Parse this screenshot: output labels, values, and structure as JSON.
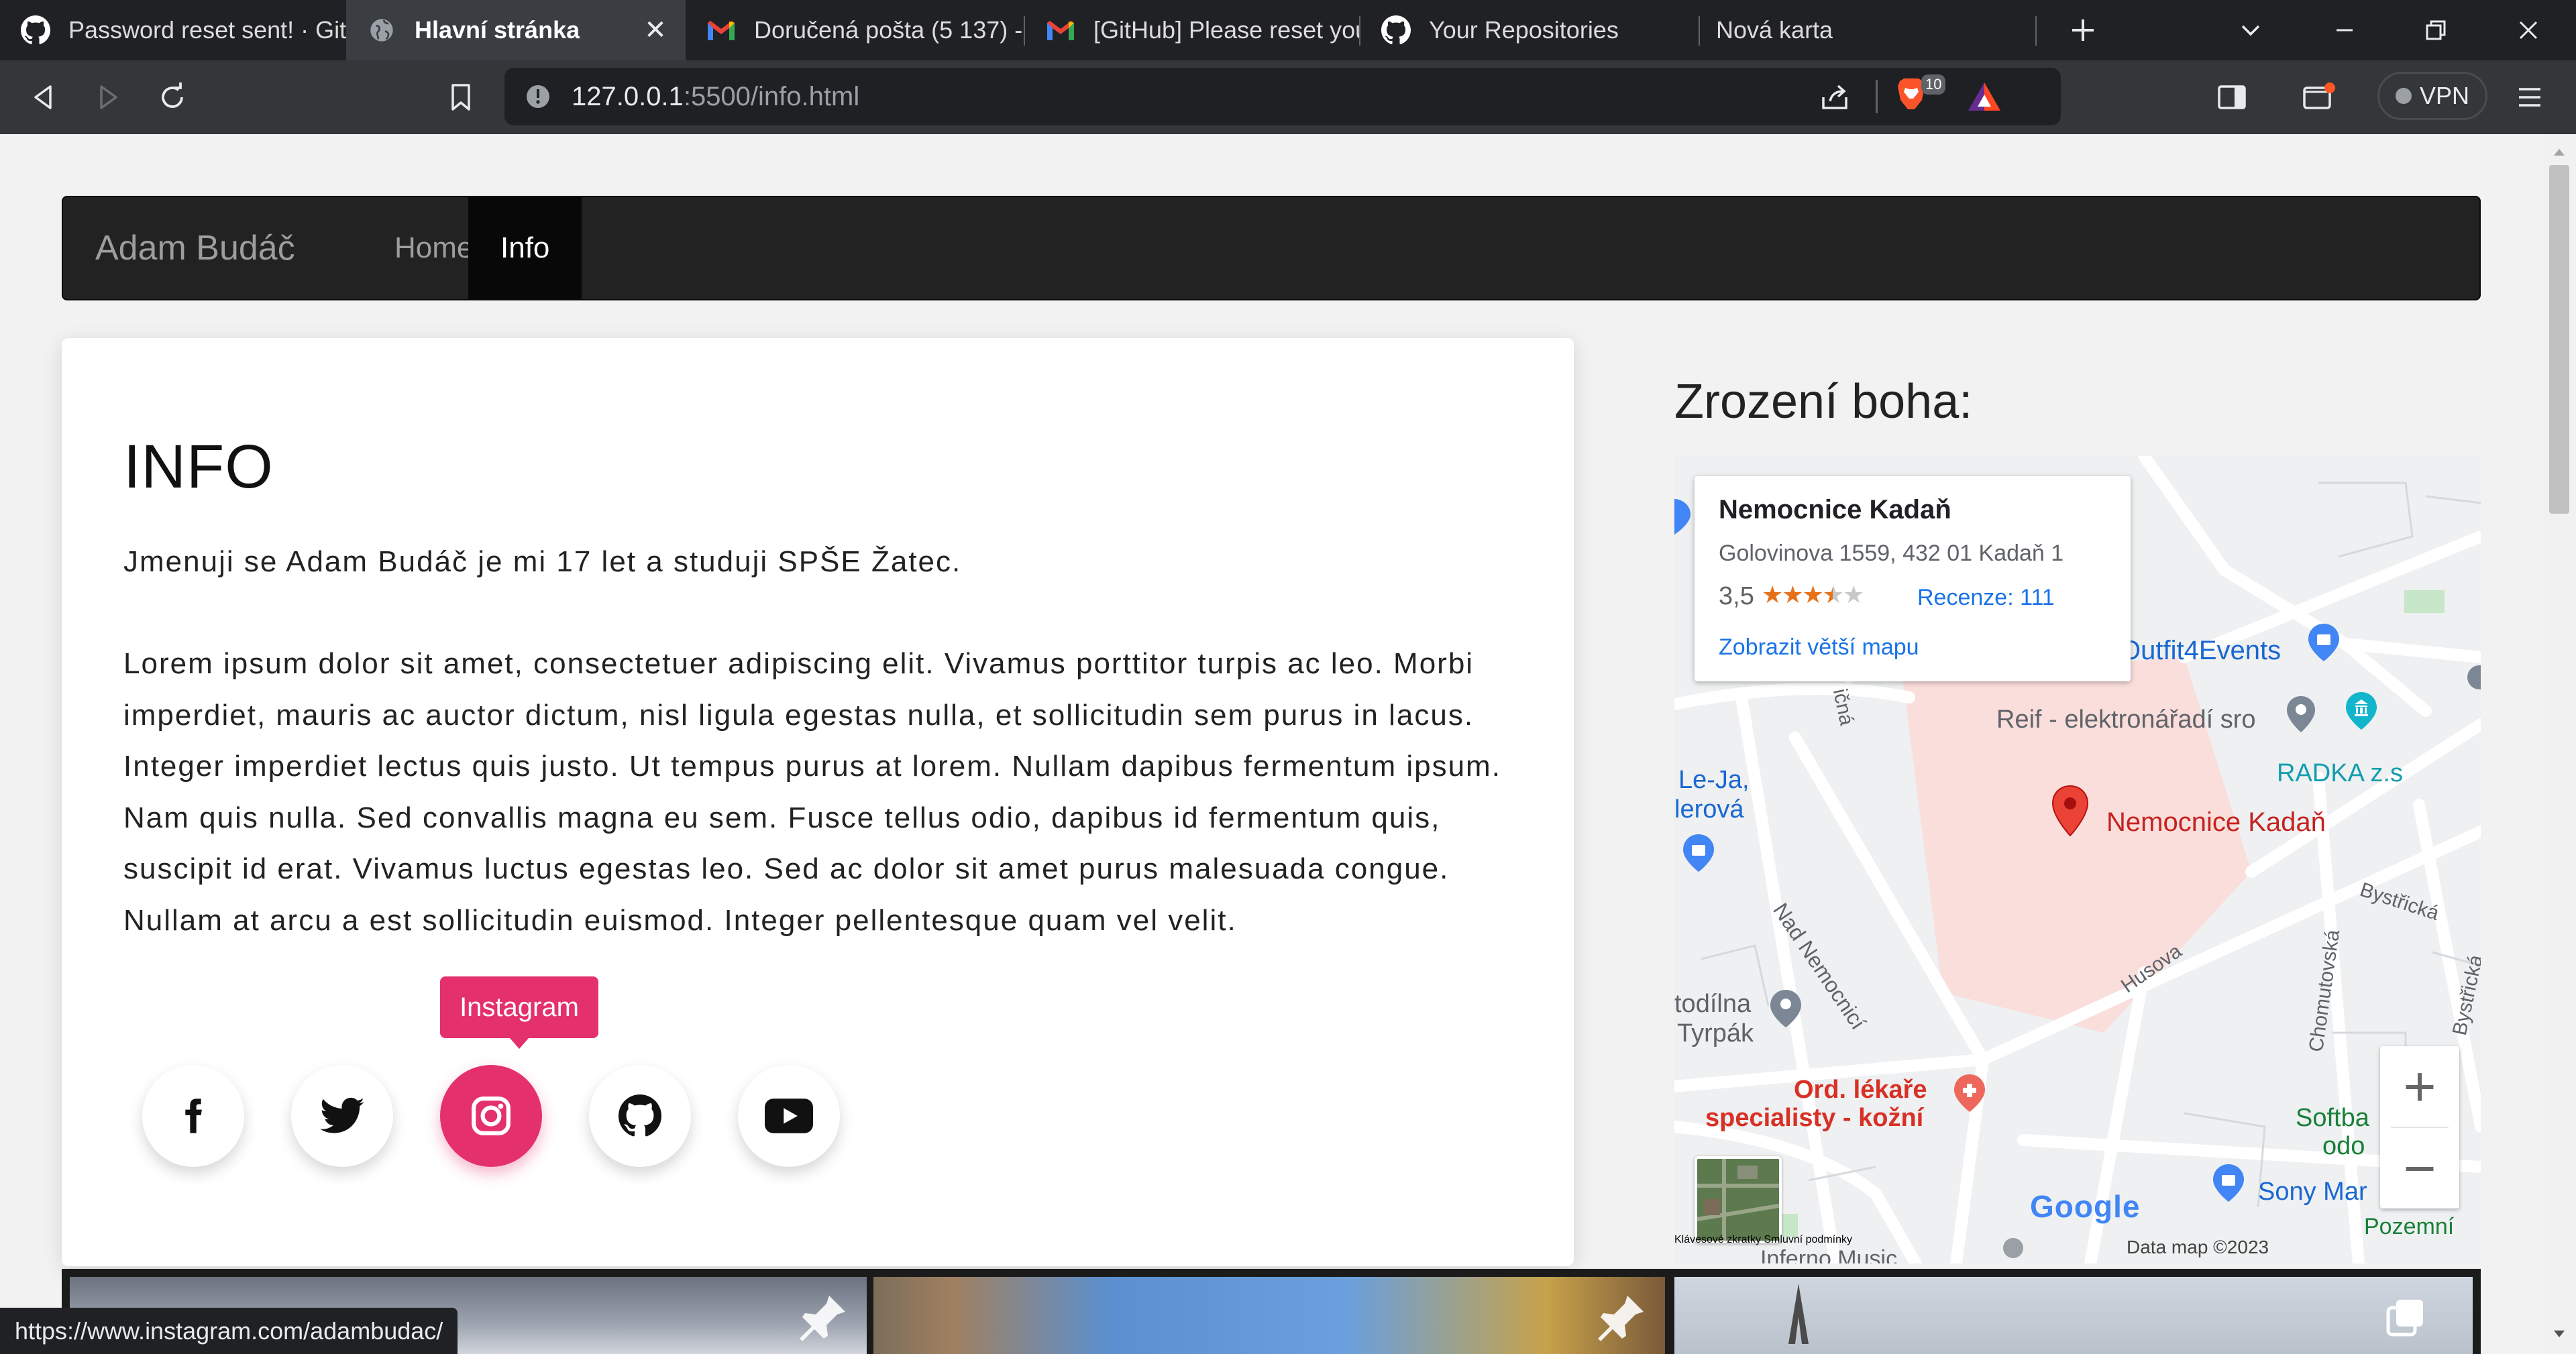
{
  "browser": {
    "tabs": [
      {
        "title": "Password reset sent! · Git",
        "icon": "github-icon"
      },
      {
        "title": "Hlavní stránka",
        "icon": "globe-icon",
        "active": true
      },
      {
        "title": "Doručená pošta (5 137) -",
        "icon": "gmail-icon"
      },
      {
        "title": "[GitHub] Please reset you",
        "icon": "gmail-icon"
      },
      {
        "title": "Your Repositories",
        "icon": "github-icon"
      },
      {
        "title": "Nová karta",
        "icon": ""
      }
    ],
    "url_host": "127.0.0.1",
    "url_rest": ":5500/info.html",
    "shields_count": "10",
    "vpn_label": "VPN",
    "status_url": "https://www.instagram.com/adambudac/"
  },
  "nav": {
    "brand": "Adam Budáč",
    "links": [
      "Home",
      "Info"
    ],
    "active": "Info"
  },
  "info": {
    "heading": "INFO",
    "intro": "Jmenuji se Adam Budáč je mi 17 let a studuji SPŠE Žatec.",
    "lorem": "Lorem ipsum dolor sit amet, consectetuer adipiscing elit. Vivamus porttitor turpis ac leo. Morbi imperdiet, mauris ac auctor dictum, nisl ligula egestas nulla, et sollicitudin sem purus in lacus. Integer imperdiet lectus quis justo. Ut tempus purus at lorem. Nullam dapibus fermentum ipsum. Nam quis nulla. Sed convallis magna eu sem. Fusce tellus odio, dapibus id fermentum quis, suscipit id erat. Vivamus luctus egestas leo. Sed ac dolor sit amet purus malesuada congue. Nullam at arcu a est sollicitudin euismod. Integer pellentesque quam vel velit.",
    "social": [
      "facebook-icon",
      "twitter-icon",
      "instagram-icon",
      "github-icon",
      "youtube-icon"
    ],
    "tooltip": "Instagram",
    "instagram_color": "#e4306c"
  },
  "map": {
    "heading": "Zrození boha:",
    "card_title": "Nemocnice Kadaň",
    "card_address": "Golovinova 1559, 432 01 Kadaň 1",
    "rating": "3,5",
    "rating_value": 3.5,
    "reviews": "Recenze: 111",
    "bigger_map": "Zobrazit větší mapu",
    "labels": {
      "hospital": "Nemocnice Kadaň",
      "outfit": "Outfit4Events",
      "reif": "Reif - elektronářadí sro",
      "radka": "RADKA z.s",
      "leja1": "Le-Ja,",
      "leja2": "lerová",
      "nad_nemocnici": "Nad Nemocnicí",
      "husova": "Husova",
      "chomutovska": "Chomutovská",
      "bystricka1": "Bystřická",
      "bystricka2": "Bystřická",
      "nicna": "ičná",
      "todilna1": "todílna",
      "todilna2": "Tyrpák",
      "ord1": "Ord. lékaře",
      "ord2": "specialisty - kožní",
      "softba1": "Softba",
      "softba2": "odo",
      "sony": "Sony Mar",
      "pozemni": "Pozemní",
      "inferno": "Inferno Music"
    },
    "zoom_in": "+",
    "zoom_out": "−",
    "google": "Google",
    "footer_shortcuts": "Klávesové zkratky",
    "footer_data": "Data map ©2023",
    "footer_terms": "Smluvní podmínky"
  }
}
